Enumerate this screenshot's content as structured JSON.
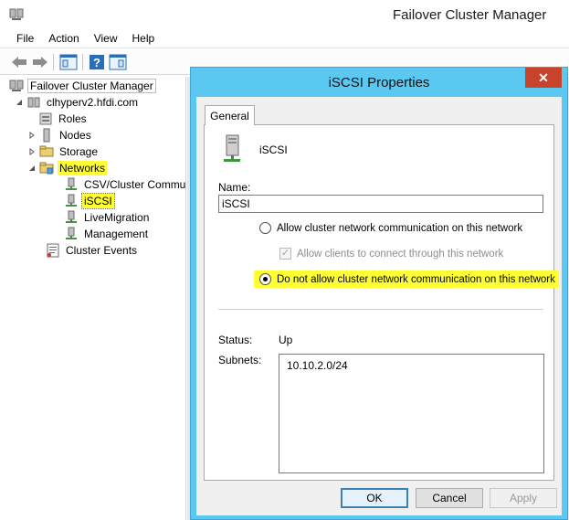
{
  "window": {
    "title": "Failover Cluster Manager"
  },
  "menu": [
    "File",
    "Action",
    "View",
    "Help"
  ],
  "toolbar": [
    "back-arrow",
    "forward-arrow",
    "show-pane",
    "help",
    "properties"
  ],
  "tree": {
    "root": "Failover Cluster Manager",
    "cluster": "clhyperv2.hfdi.com",
    "items": [
      {
        "label": "Roles"
      },
      {
        "label": "Nodes"
      },
      {
        "label": "Storage"
      },
      {
        "label": "Networks"
      }
    ],
    "networks": [
      "CSV/Cluster Commu",
      "iSCSI",
      "LiveMigration",
      "Management"
    ],
    "events": "Cluster Events"
  },
  "dialog": {
    "title": "iSCSI Properties",
    "close": "✕",
    "tab": "General",
    "network_name": "iSCSI",
    "name_label": "Name:",
    "name_value": "iSCSI",
    "option_allow": "Allow cluster network communication on this network",
    "option_clients": "Allow clients to connect through this network",
    "option_deny": "Do not allow cluster network communication on this network",
    "status_label": "Status:",
    "status_value": "Up",
    "subnets_label": "Subnets:",
    "subnets": [
      "10.10.2.0/24"
    ],
    "buttons": {
      "ok": "OK",
      "cancel": "Cancel",
      "apply": "Apply"
    }
  },
  "colors": {
    "dialog_frame": "#5ac8f1",
    "highlight": "#ffff33",
    "close": "#c7432b"
  }
}
